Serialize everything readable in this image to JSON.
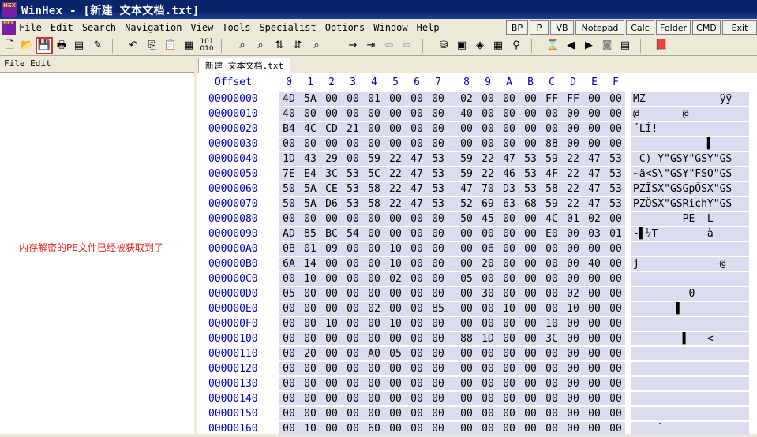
{
  "window": {
    "title": "WinHex - [新建 文本文档.txt]",
    "icon_label": "HEX"
  },
  "menu": {
    "items": [
      "File",
      "Edit",
      "Search",
      "Navigation",
      "View",
      "Tools",
      "Specialist",
      "Options",
      "Window",
      "Help"
    ],
    "buttons": [
      "BP",
      "P",
      "VB",
      "Notepad",
      "Calc",
      "Folder",
      "CMD",
      "Exit"
    ]
  },
  "left_pane": {
    "header": "File Edit"
  },
  "annotation": "内存解密的PE文件已经被获取到了",
  "tab": "新建 文本文档.txt",
  "hex_header": {
    "offset": "Offset",
    "cols": [
      "0",
      "1",
      "2",
      "3",
      "4",
      "5",
      "6",
      "7",
      "8",
      "9",
      "A",
      "B",
      "C",
      "D",
      "E",
      "F"
    ]
  },
  "rows": [
    {
      "off": "00000000",
      "bytes": [
        "4D",
        "5A",
        "00",
        "00",
        "01",
        "00",
        "00",
        "00",
        "02",
        "00",
        "00",
        "00",
        "FF",
        "FF",
        "00",
        "00"
      ],
      "ascii": "MZ            ÿÿ"
    },
    {
      "off": "00000010",
      "bytes": [
        "40",
        "00",
        "00",
        "00",
        "00",
        "00",
        "00",
        "00",
        "40",
        "00",
        "00",
        "00",
        "00",
        "00",
        "00",
        "00"
      ],
      "ascii": "@       @       "
    },
    {
      "off": "00000020",
      "bytes": [
        "B4",
        "4C",
        "CD",
        "21",
        "00",
        "00",
        "00",
        "00",
        "00",
        "00",
        "00",
        "00",
        "00",
        "00",
        "00",
        "00"
      ],
      "ascii": "´LÍ!            "
    },
    {
      "off": "00000030",
      "bytes": [
        "00",
        "00",
        "00",
        "00",
        "00",
        "00",
        "00",
        "00",
        "00",
        "00",
        "00",
        "00",
        "88",
        "00",
        "00",
        "00"
      ],
      "ascii": "            ▌   "
    },
    {
      "off": "00000040",
      "bytes": [
        "1D",
        "43",
        "29",
        "00",
        "59",
        "22",
        "47",
        "53",
        "59",
        "22",
        "47",
        "53",
        "59",
        "22",
        "47",
        "53"
      ],
      "ascii": " C) Y\"GSY\"GSY\"GS"
    },
    {
      "off": "00000050",
      "bytes": [
        "7E",
        "E4",
        "3C",
        "53",
        "5C",
        "22",
        "47",
        "53",
        "59",
        "22",
        "46",
        "53",
        "4F",
        "22",
        "47",
        "53"
      ],
      "ascii": "~ä<S\\\"GSY\"FSO\"GS"
    },
    {
      "off": "00000060",
      "bytes": [
        "50",
        "5A",
        "CE",
        "53",
        "58",
        "22",
        "47",
        "53",
        "47",
        "70",
        "D3",
        "53",
        "58",
        "22",
        "47",
        "53"
      ],
      "ascii": "PZÎSX\"GSGpÓSX\"GS"
    },
    {
      "off": "00000070",
      "bytes": [
        "50",
        "5A",
        "D6",
        "53",
        "58",
        "22",
        "47",
        "53",
        "52",
        "69",
        "63",
        "68",
        "59",
        "22",
        "47",
        "53"
      ],
      "ascii": "PZÖSX\"GSRichY\"GS"
    },
    {
      "off": "00000080",
      "bytes": [
        "00",
        "00",
        "00",
        "00",
        "00",
        "00",
        "00",
        "00",
        "50",
        "45",
        "00",
        "00",
        "4C",
        "01",
        "02",
        "00"
      ],
      "ascii": "        PE  L   "
    },
    {
      "off": "00000090",
      "bytes": [
        "AD",
        "85",
        "BC",
        "54",
        "00",
        "00",
        "00",
        "00",
        "00",
        "00",
        "00",
        "00",
        "E0",
        "00",
        "03",
        "01"
      ],
      "ascii": "-▌¼T        à   "
    },
    {
      "off": "000000A0",
      "bytes": [
        "0B",
        "01",
        "09",
        "00",
        "00",
        "10",
        "00",
        "00",
        "00",
        "06",
        "00",
        "00",
        "00",
        "00",
        "00",
        "00"
      ],
      "ascii": "                "
    },
    {
      "off": "000000B0",
      "bytes": [
        "6A",
        "14",
        "00",
        "00",
        "00",
        "10",
        "00",
        "00",
        "00",
        "20",
        "00",
        "00",
        "00",
        "00",
        "40",
        "00"
      ],
      "ascii": "j             @ "
    },
    {
      "off": "000000C0",
      "bytes": [
        "00",
        "10",
        "00",
        "00",
        "00",
        "02",
        "00",
        "00",
        "05",
        "00",
        "00",
        "00",
        "00",
        "00",
        "00",
        "00"
      ],
      "ascii": "                "
    },
    {
      "off": "000000D0",
      "bytes": [
        "05",
        "00",
        "00",
        "00",
        "00",
        "00",
        "00",
        "00",
        "00",
        "30",
        "00",
        "00",
        "00",
        "02",
        "00",
        "00"
      ],
      "ascii": "         0      "
    },
    {
      "off": "000000E0",
      "bytes": [
        "00",
        "00",
        "00",
        "00",
        "02",
        "00",
        "00",
        "85",
        "00",
        "00",
        "10",
        "00",
        "00",
        "10",
        "00",
        "00"
      ],
      "ascii": "       ▌        "
    },
    {
      "off": "000000F0",
      "bytes": [
        "00",
        "00",
        "10",
        "00",
        "00",
        "10",
        "00",
        "00",
        "00",
        "00",
        "00",
        "00",
        "10",
        "00",
        "00",
        "00"
      ],
      "ascii": "                "
    },
    {
      "off": "00000100",
      "bytes": [
        "00",
        "00",
        "00",
        "00",
        "00",
        "00",
        "00",
        "00",
        "88",
        "1D",
        "00",
        "00",
        "3C",
        "00",
        "00",
        "00"
      ],
      "ascii": "        ▌   <   "
    },
    {
      "off": "00000110",
      "bytes": [
        "00",
        "20",
        "00",
        "00",
        "A0",
        "05",
        "00",
        "00",
        "00",
        "00",
        "00",
        "00",
        "00",
        "00",
        "00",
        "00"
      ],
      "ascii": "                "
    },
    {
      "off": "00000120",
      "bytes": [
        "00",
        "00",
        "00",
        "00",
        "00",
        "00",
        "00",
        "00",
        "00",
        "00",
        "00",
        "00",
        "00",
        "00",
        "00",
        "00"
      ],
      "ascii": "                "
    },
    {
      "off": "00000130",
      "bytes": [
        "00",
        "00",
        "00",
        "00",
        "00",
        "00",
        "00",
        "00",
        "00",
        "00",
        "00",
        "00",
        "00",
        "00",
        "00",
        "00"
      ],
      "ascii": "                "
    },
    {
      "off": "00000140",
      "bytes": [
        "00",
        "00",
        "00",
        "00",
        "00",
        "00",
        "00",
        "00",
        "00",
        "00",
        "00",
        "00",
        "00",
        "00",
        "00",
        "00"
      ],
      "ascii": "                "
    },
    {
      "off": "00000150",
      "bytes": [
        "00",
        "00",
        "00",
        "00",
        "00",
        "00",
        "00",
        "00",
        "00",
        "00",
        "00",
        "00",
        "00",
        "00",
        "00",
        "00"
      ],
      "ascii": "                "
    },
    {
      "off": "00000160",
      "bytes": [
        "00",
        "10",
        "00",
        "00",
        "60",
        "00",
        "00",
        "00",
        "00",
        "00",
        "00",
        "00",
        "00",
        "00",
        "00",
        "00"
      ],
      "ascii": "    `           "
    }
  ]
}
